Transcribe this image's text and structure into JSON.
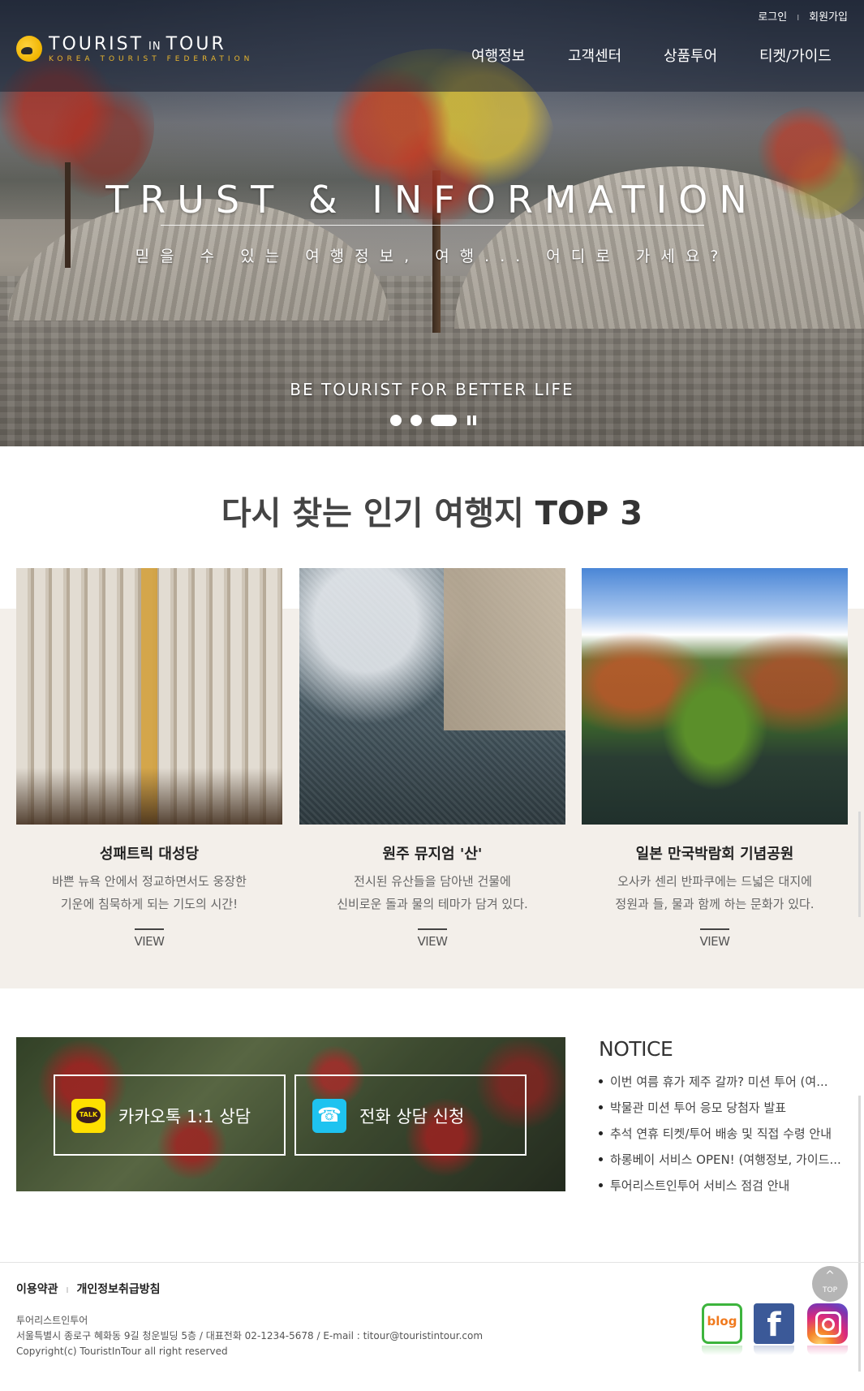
{
  "header": {
    "logo": {
      "main": "TOURIST",
      "in": "IN",
      "tail": "TOUR",
      "sub": "KOREA TOURIST FEDERATION"
    },
    "util": {
      "login": "로그인",
      "separator": "I",
      "join": "회원가입"
    },
    "nav": [
      "여행정보",
      "고객센터",
      "상품투어",
      "티켓/가이드"
    ]
  },
  "hero": {
    "title": "TRUST & INFORMATION",
    "subtitle": "믿을 수 있는 여행정보, 여행... 어디로 가세요?",
    "tagline": "BE TOURIST FOR BETTER LIFE",
    "slides": 3,
    "active_slide": 3
  },
  "top3": {
    "title_prefix": "다시 찾는 인기 여행지",
    "title_bold": "TOP 3",
    "view_label": "VIEW",
    "cards": [
      {
        "title": "성패트릭 대성당",
        "desc1": "바쁜 뉴욕 안에서 정교하면서도 웅장한",
        "desc2": "기운에 침묵하게 되는 기도의 시간!"
      },
      {
        "title": "원주 뮤지엄 '산'",
        "desc1": "전시된 유산들을 담아낸 건물에",
        "desc2": "신비로운 돌과 물의 테마가 담겨 있다."
      },
      {
        "title": "일본 만국박람회 기념공원",
        "desc1": "오사카 센리 반파쿠에는 드넓은 대지에",
        "desc2": "정원과 들, 물과 함께 하는 문화가 있다."
      }
    ]
  },
  "consult": {
    "kakao_label": "카카오톡 1:1 상담",
    "phone_label": "전화 상담 신청"
  },
  "notice": {
    "title": "NOTICE",
    "items": [
      "이번 여름 휴가 제주 갈까? 미션 투어 (여...",
      "박물관 미션 투어 응모 당첨자 발표",
      "추석 연휴 티켓/투어 배송 및 직접 수령 안내",
      "하롱베이 서비스 OPEN! (여행정보, 가이드...",
      "투어리스트인투어 서비스 점검 안내"
    ]
  },
  "footer": {
    "terms": "이용약관",
    "sep": "I",
    "privacy": "개인정보취급방침",
    "company": "투어리스트인투어",
    "address": "서울특별시 종로구 혜화동 9길 청운빌딩 5층 / 대표전화 02-1234-5678 / E-mail : titour@touristintour.com",
    "copyright": "Copyright(c) TouristInTour all right reserved",
    "top_label": "TOP",
    "top_chevron": "^"
  },
  "colors": {
    "accent_gold": "#e8b62e",
    "beige_bg": "#f3efea",
    "kakao": "#ffe000",
    "phone": "#1ec3f0",
    "facebook": "#3b5998",
    "blog_green": "#3db43d"
  },
  "icons": [
    "logo-sun-icon",
    "kakao-talk-icon",
    "phone-icon",
    "blog-icon",
    "facebook-icon",
    "instagram-icon",
    "top-arrow-icon",
    "pause-icon"
  ]
}
